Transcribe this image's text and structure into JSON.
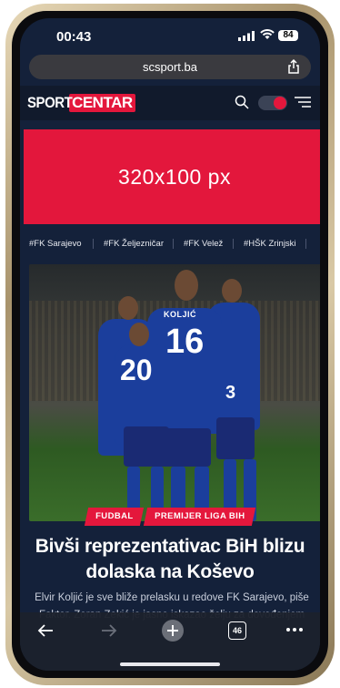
{
  "status": {
    "time": "00:43",
    "battery": "84"
  },
  "browser": {
    "url": "scsport.ba",
    "tab_count": "46"
  },
  "site": {
    "logo_part1": "SPORT",
    "logo_part2": "CENTAR",
    "ad_label": "320x100 px",
    "tags": [
      "#FK Sarajevo",
      "#FK Željezničar",
      "#FK Velež",
      "#HŠK Zrinjski"
    ]
  },
  "article": {
    "categories": [
      "FUDBAL",
      "PREMIJER LIGA BIH"
    ],
    "title": "Bivši reprezentativac BiH blizu dolaska na Koševo",
    "excerpt": "Elvir Koljić je sve bliže prelasku u redove FK Sarajevo, piše Faktor. Zoran Zekić je jasno iskazao želju za dovođenjem",
    "photo_jersey_numbers": [
      "16",
      "20",
      "3"
    ],
    "photo_jersey_name": "KOLJIĆ"
  },
  "colors": {
    "brand_red": "#e4173c",
    "header_bg": "#111a2c",
    "page_bg": "#14213a"
  }
}
